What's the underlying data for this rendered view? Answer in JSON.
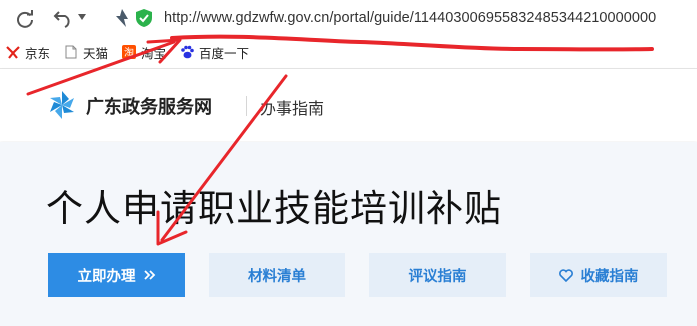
{
  "browser": {
    "url": "http://www.gdzwfw.gov.cn/portal/guide/114403006955832485344210000000",
    "icons": {
      "reload": "reload-icon",
      "back": "back-icon",
      "dropdown": "chevron-down-icon",
      "lightning": "lightning-icon",
      "secure": "shield-check-icon"
    },
    "bookmarks": [
      {
        "label": "京东",
        "icon": "jd-icon"
      },
      {
        "label": "天猫",
        "icon": "page-icon"
      },
      {
        "label": "淘宝",
        "icon": "taobao-icon"
      },
      {
        "label": "百度一下",
        "icon": "baidu-icon"
      }
    ]
  },
  "header": {
    "site_name": "广东政务服务网",
    "section": "办事指南",
    "logo_icon": "pinwheel-logo-icon"
  },
  "main": {
    "title": "个人申请职业技能培训补贴",
    "buttons": {
      "apply": "立即办理",
      "apply_icon": "double-chevron-right-icon",
      "materials": "材料清单",
      "review": "评议指南",
      "favorite": "收藏指南",
      "favorite_icon": "heart-icon"
    }
  },
  "colors": {
    "primary": "#2d8ce4",
    "secondary_bg": "#e5eef8",
    "secondary_text": "#2a7fd4",
    "annotation": "#e8262b"
  }
}
